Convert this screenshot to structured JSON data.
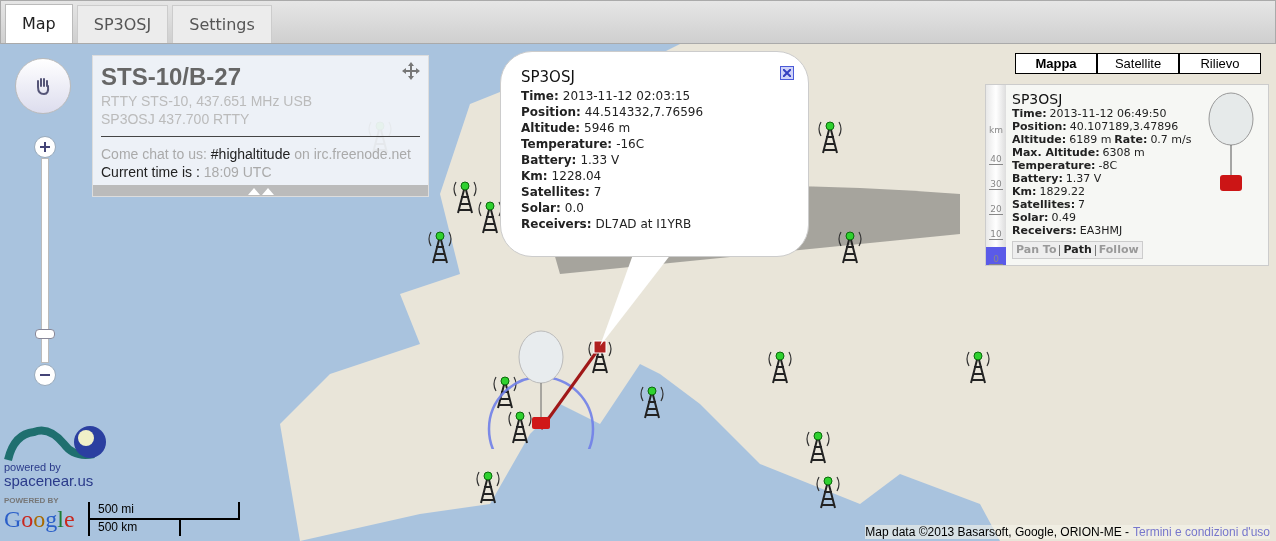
{
  "tabs": [
    {
      "label": "Map",
      "selected": true
    },
    {
      "label": "SP3OSJ",
      "selected": false
    },
    {
      "label": "Settings",
      "selected": false
    }
  ],
  "info_panel": {
    "title": "STS-10/B-27",
    "lines": [
      "RTTY STS-10, 437.651 MHz USB",
      "SP3OSJ 437.700 RTTY"
    ],
    "chat": {
      "prefix": "Come chat to us:",
      "channel": "#highaltitude",
      "suffix": "on irc.freenode.net"
    },
    "time": {
      "label": "Current time is :",
      "value": "18:09 UTC"
    }
  },
  "popup": {
    "title": "SP3OSJ",
    "fields": [
      {
        "label": "Time:",
        "value": "2013-11-12 02:03:15"
      },
      {
        "label": "Position:",
        "value": "44.514332,7.76596"
      },
      {
        "label": "Altitude:",
        "value": "5946 m"
      },
      {
        "label": "Temperature:",
        "value": "-16C"
      },
      {
        "label": "Battery:",
        "value": "1.33 V"
      },
      {
        "label": "Km:",
        "value": "1228.04"
      },
      {
        "label": "Satellites:",
        "value": "7"
      },
      {
        "label": "Solar:",
        "value": "0.0"
      },
      {
        "label": "Receivers:",
        "value": "DL7AD at I1YRB"
      }
    ]
  },
  "map_types": [
    {
      "label": "Mappa",
      "selected": true
    },
    {
      "label": "Satellite",
      "selected": false
    },
    {
      "label": "Rilievo",
      "selected": false
    }
  ],
  "tracker_panel": {
    "title": "SP3OSJ",
    "lines": [
      [
        {
          "label": "Time:",
          "value": "2013-11-12 06:49:50"
        }
      ],
      [
        {
          "label": "Position:",
          "value": "40.107189,3.47896"
        }
      ],
      [
        {
          "label": "Altitude:",
          "value": "6189 m"
        },
        {
          "label": "Rate:",
          "value": "0.7 m/s"
        }
      ],
      [
        {
          "label": "Max. Altitude:",
          "value": "6308 m"
        }
      ],
      [
        {
          "label": "Temperature:",
          "value": "-8C"
        }
      ],
      [
        {
          "label": "Battery:",
          "value": "1.37 V"
        }
      ],
      [
        {
          "label": "Km:",
          "value": "1829.22"
        }
      ],
      [
        {
          "label": "Satellites:",
          "value": "7"
        }
      ],
      [
        {
          "label": "Solar:",
          "value": "0.49"
        }
      ],
      [
        {
          "label": "Receivers:",
          "value": "EA3HMJ"
        }
      ]
    ],
    "altitude_scale": {
      "unit": "km",
      "ticks": [
        "40",
        "30",
        "20",
        "10",
        "0"
      ],
      "level": 0.1
    },
    "actions": [
      {
        "label": "Pan To",
        "selected": false
      },
      {
        "label": "Path",
        "selected": true
      },
      {
        "label": "Follow",
        "selected": false
      }
    ]
  },
  "logos": {
    "spacenear": {
      "tagline": "powered by",
      "name": "spacenear.us"
    },
    "google": {
      "tagline": "POWERED BY",
      "name": "Google"
    }
  },
  "scale": [
    "500 mi",
    "500 km"
  ],
  "attribution": {
    "text": "Map data ©2013 Basarsoft, Google, ORION-ME -",
    "link": "Termini e condizioni d'uso"
  }
}
